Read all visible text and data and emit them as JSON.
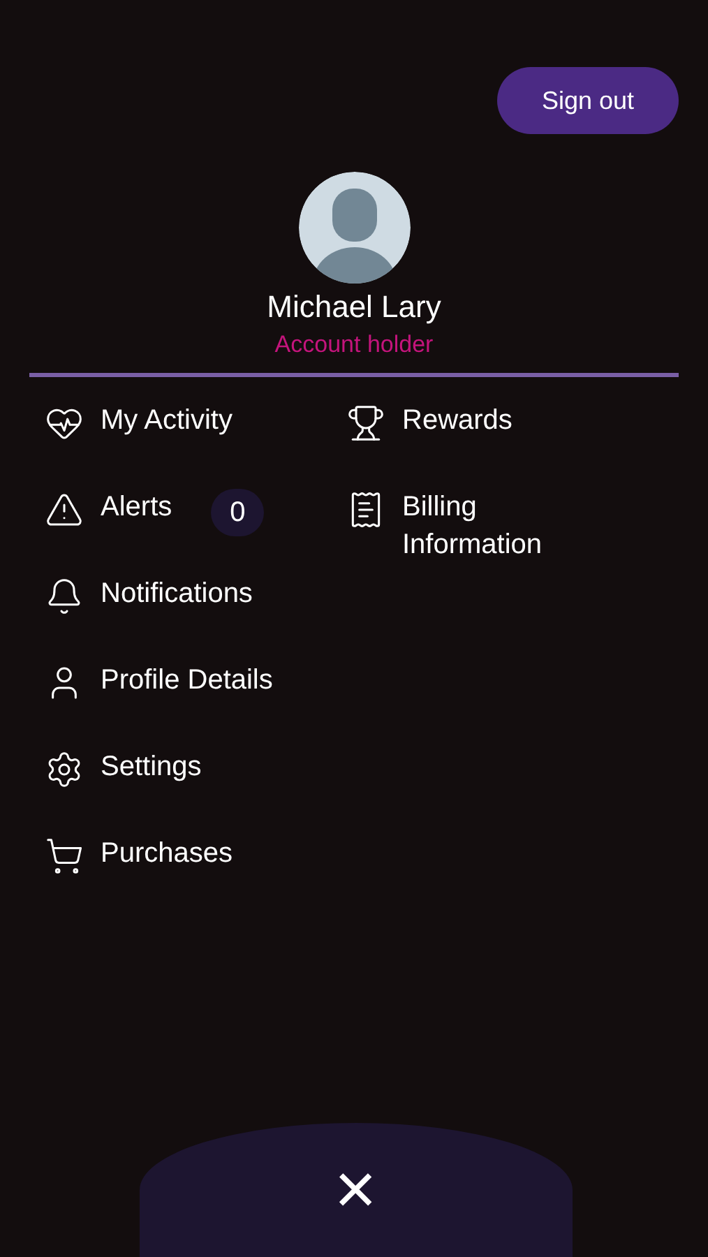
{
  "sign_out": {
    "label": "Sign out"
  },
  "profile": {
    "name": "Michael Lary",
    "role": "Account holder"
  },
  "menu_left": [
    {
      "label": "My Activity"
    },
    {
      "label": "Alerts",
      "badge": "0"
    },
    {
      "label": "Notifications"
    },
    {
      "label": "Profile Details"
    },
    {
      "label": "Settings"
    },
    {
      "label": "Purchases"
    }
  ],
  "menu_right": [
    {
      "label": "Rewards"
    },
    {
      "label": "Billing Information"
    }
  ],
  "close": {
    "label": "×"
  }
}
